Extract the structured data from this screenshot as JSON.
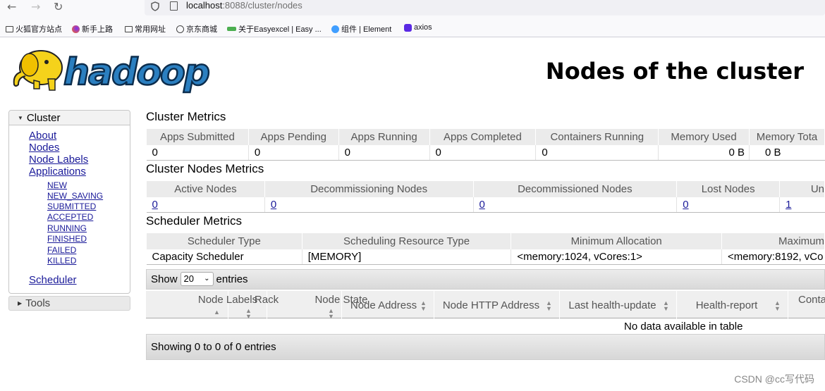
{
  "browser": {
    "url_host": "localhost",
    "url_rest": ":8088/cluster/nodes",
    "bookmarks": [
      {
        "label": "火狐官方站点",
        "icon": "folder-icon"
      },
      {
        "label": "新手上路",
        "icon": "firefox-icon"
      },
      {
        "label": "常用网址",
        "icon": "folder-icon"
      },
      {
        "label": "京东商城",
        "icon": "globe-icon"
      },
      {
        "label": "关于Easyexcel | Easy ...",
        "icon": "site-icon"
      },
      {
        "label": "组件 | Element",
        "icon": "element-icon"
      },
      {
        "label": "axios",
        "icon": "axios-icon"
      }
    ]
  },
  "header": {
    "logo_text": "hadoop",
    "title": "Nodes of the cluster"
  },
  "sidebar": {
    "cluster_label": "Cluster",
    "links": [
      "About",
      "Nodes",
      "Node Labels",
      "Applications"
    ],
    "app_states": [
      "NEW",
      "NEW_SAVING",
      "SUBMITTED",
      "ACCEPTED",
      "RUNNING",
      "FINISHED",
      "FAILED",
      "KILLED"
    ],
    "scheduler": "Scheduler",
    "tools_label": "Tools"
  },
  "cluster_metrics": {
    "title": "Cluster Metrics",
    "headers": [
      "Apps Submitted",
      "Apps Pending",
      "Apps Running",
      "Apps Completed",
      "Containers Running",
      "Memory Used",
      "Memory Tota"
    ],
    "values": [
      "0",
      "0",
      "0",
      "0",
      "0",
      "0 B",
      "0 B"
    ]
  },
  "nodes_metrics": {
    "title": "Cluster Nodes Metrics",
    "headers": [
      "Active Nodes",
      "Decommissioning Nodes",
      "Decommissioned Nodes",
      "Lost Nodes",
      "Un"
    ],
    "values": [
      "0",
      "0",
      "0",
      "0",
      "1"
    ]
  },
  "scheduler_metrics": {
    "title": "Scheduler Metrics",
    "headers": [
      "Scheduler Type",
      "Scheduling Resource Type",
      "Minimum Allocation",
      "Maximum"
    ],
    "values": [
      "Capacity Scheduler",
      "[MEMORY]",
      "<memory:1024, vCores:1>",
      "<memory:8192, vCo"
    ]
  },
  "nodes_table": {
    "show_label": "Show",
    "page_size": "20",
    "entries_label": "entries",
    "columns": [
      "Node Labels",
      "Rack",
      "Node State",
      "Node Address",
      "Node HTTP Address",
      "Last health-update",
      "Health-report",
      "Conta"
    ],
    "empty": "No data available in table",
    "footer": "Showing 0 to 0 of 0 entries"
  },
  "watermark": "CSDN @cc写代码",
  "colors": {
    "link": "#1a1a99",
    "header_bg": "#ebebeb",
    "logo_yellow": "#f5d21b",
    "logo_blue": "#2b7fc0"
  }
}
